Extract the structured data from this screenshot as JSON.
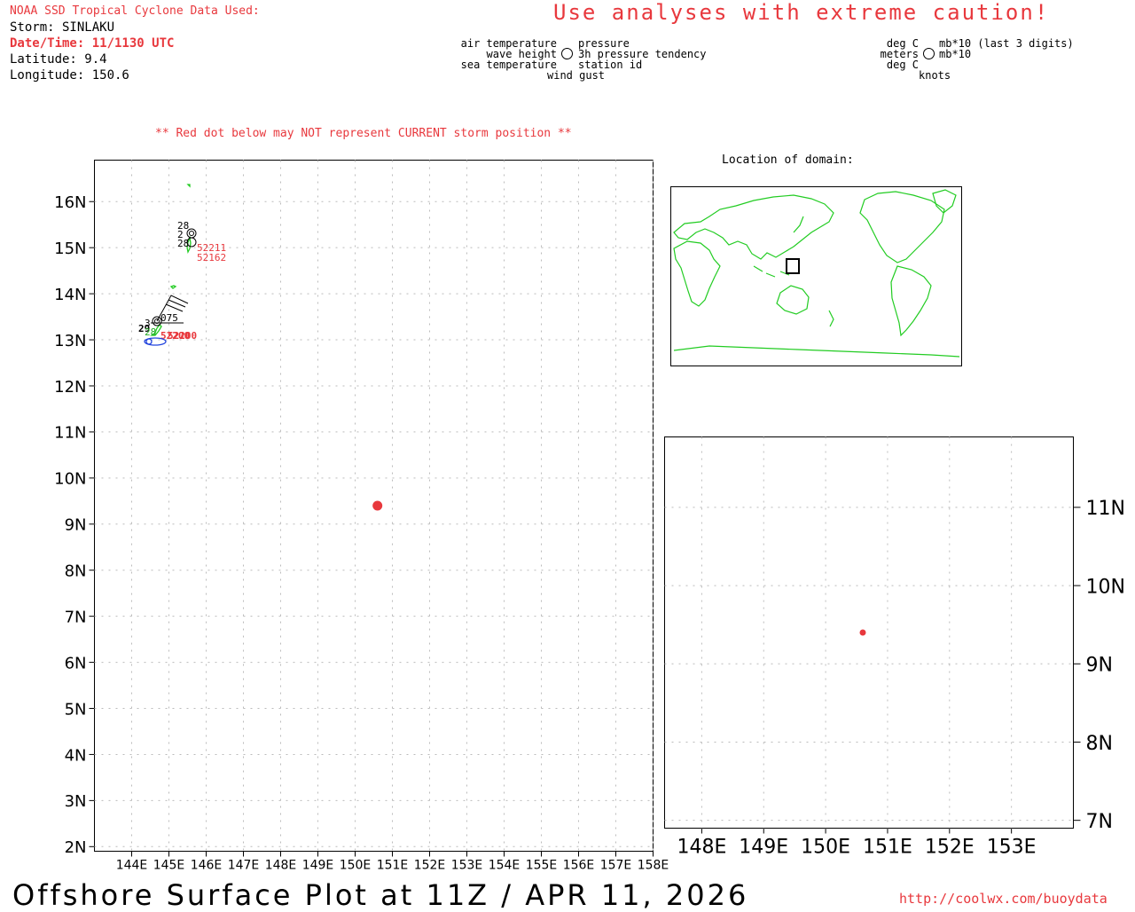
{
  "header": {
    "source": "NOAA SSD Tropical Cyclone Data Used:",
    "storm": "Storm: SINLAKU",
    "datetime": "Date/Time: 11/1130 UTC",
    "latitude": "Latitude: 9.4",
    "longitude": "Longitude: 150.6",
    "caution": "Use analyses with extreme caution!"
  },
  "legend": {
    "left_labels": [
      "air temperature",
      "wave height",
      "sea temperature"
    ],
    "right_labels": [
      "pressure",
      "3h pressure tendency",
      "station id"
    ],
    "bottom_label": "wind gust",
    "units_left": [
      "deg C",
      "meters",
      "deg C"
    ],
    "units_right": [
      "mb*10 (last 3 digits)",
      "mb*10"
    ],
    "units_bottom": "knots"
  },
  "warning": "** Red dot below may NOT represent CURRENT storm position **",
  "location_title": "Location of domain:",
  "bottom_title": "Offshore Surface Plot at 11Z / APR 11, 2026",
  "url": "http://coolwx.com/buoydata",
  "colors": {
    "red": "#e8383d",
    "green": "#22cc22",
    "blue": "#2244dd",
    "grid": "#bbbbbb"
  },
  "map_data": {
    "main": {
      "lon_range": [
        143,
        158
      ],
      "lat_range": [
        1.9,
        16.9
      ],
      "lon_ticks": [
        144,
        145,
        146,
        147,
        148,
        149,
        150,
        151,
        152,
        153,
        154,
        155,
        156,
        157,
        158
      ],
      "lon_labels": [
        "144E",
        "145E",
        "146E",
        "147E",
        "148E",
        "149E",
        "150E",
        "151E",
        "152E",
        "153E",
        "154E",
        "155E",
        "156E",
        "157E",
        "158E"
      ],
      "lat_ticks": [
        2,
        3,
        4,
        5,
        6,
        7,
        8,
        9,
        10,
        11,
        12,
        13,
        14,
        15,
        16
      ],
      "lat_labels": [
        "2N",
        "3N",
        "4N",
        "5N",
        "6N",
        "7N",
        "8N",
        "9N",
        "10N",
        "11N",
        "12N",
        "13N",
        "14N",
        "15N",
        "16N"
      ]
    },
    "zoom": {
      "lon_range": [
        147.4,
        154
      ],
      "lat_range": [
        6.9,
        11.9
      ],
      "lon_ticks": [
        148,
        149,
        150,
        151,
        152,
        153
      ],
      "lon_labels": [
        "148E",
        "149E",
        "150E",
        "151E",
        "152E",
        "153E"
      ],
      "lat_ticks": [
        7,
        8,
        9,
        10,
        11
      ],
      "lat_labels": [
        "7N",
        "8N",
        "9N",
        "10N",
        "11N"
      ]
    },
    "storm": {
      "lat": 9.4,
      "lon": 150.6
    },
    "stations": [
      {
        "id": "52211",
        "lon": 145.7,
        "lat": 15.1,
        "air": "28",
        "wave": "2",
        "sea": "28"
      },
      {
        "id": "52162",
        "lon": 145.65,
        "lat": 15.3,
        "air": "28"
      },
      {
        "id": "52200",
        "lon": 144.8,
        "lat": 13.4,
        "air": "29",
        "wave": "3",
        "sea": "28",
        "pressure": "075"
      }
    ]
  }
}
